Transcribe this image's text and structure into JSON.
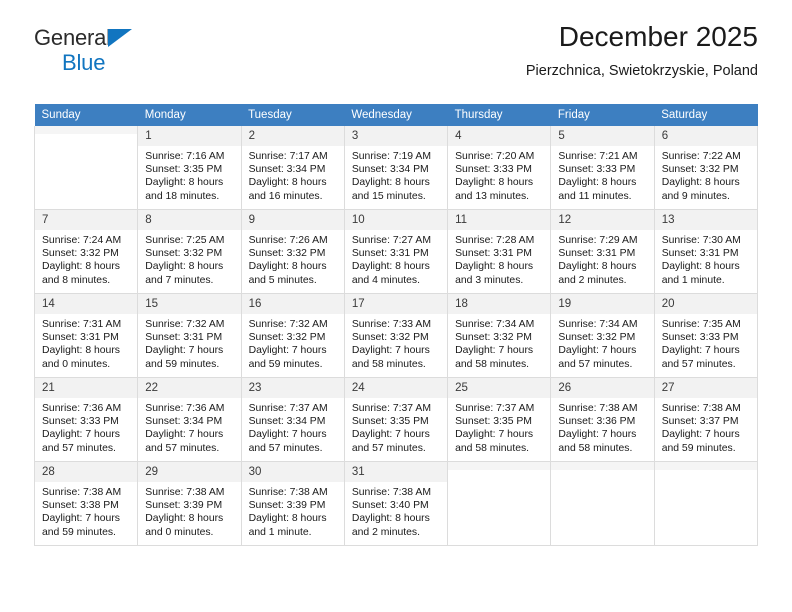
{
  "brand": {
    "line1": "General",
    "line2": "Blue",
    "triangle_icon": "triangle-logo-icon",
    "accent_color": "#1175c0"
  },
  "header": {
    "title": "December 2025",
    "subtitle": "Pierzchnica, Swietokrzyskie, Poland"
  },
  "calendar": {
    "header_bg": "#3d7fc1",
    "weekday_headers": [
      "Sunday",
      "Monday",
      "Tuesday",
      "Wednesday",
      "Thursday",
      "Friday",
      "Saturday"
    ],
    "weeks": [
      [
        {
          "day": "",
          "sunrise": "",
          "sunset": "",
          "daylight1": "",
          "daylight2": ""
        },
        {
          "day": "1",
          "sunrise": "Sunrise: 7:16 AM",
          "sunset": "Sunset: 3:35 PM",
          "daylight1": "Daylight: 8 hours",
          "daylight2": "and 18 minutes."
        },
        {
          "day": "2",
          "sunrise": "Sunrise: 7:17 AM",
          "sunset": "Sunset: 3:34 PM",
          "daylight1": "Daylight: 8 hours",
          "daylight2": "and 16 minutes."
        },
        {
          "day": "3",
          "sunrise": "Sunrise: 7:19 AM",
          "sunset": "Sunset: 3:34 PM",
          "daylight1": "Daylight: 8 hours",
          "daylight2": "and 15 minutes."
        },
        {
          "day": "4",
          "sunrise": "Sunrise: 7:20 AM",
          "sunset": "Sunset: 3:33 PM",
          "daylight1": "Daylight: 8 hours",
          "daylight2": "and 13 minutes."
        },
        {
          "day": "5",
          "sunrise": "Sunrise: 7:21 AM",
          "sunset": "Sunset: 3:33 PM",
          "daylight1": "Daylight: 8 hours",
          "daylight2": "and 11 minutes."
        },
        {
          "day": "6",
          "sunrise": "Sunrise: 7:22 AM",
          "sunset": "Sunset: 3:32 PM",
          "daylight1": "Daylight: 8 hours",
          "daylight2": "and 9 minutes."
        }
      ],
      [
        {
          "day": "7",
          "sunrise": "Sunrise: 7:24 AM",
          "sunset": "Sunset: 3:32 PM",
          "daylight1": "Daylight: 8 hours",
          "daylight2": "and 8 minutes."
        },
        {
          "day": "8",
          "sunrise": "Sunrise: 7:25 AM",
          "sunset": "Sunset: 3:32 PM",
          "daylight1": "Daylight: 8 hours",
          "daylight2": "and 7 minutes."
        },
        {
          "day": "9",
          "sunrise": "Sunrise: 7:26 AM",
          "sunset": "Sunset: 3:32 PM",
          "daylight1": "Daylight: 8 hours",
          "daylight2": "and 5 minutes."
        },
        {
          "day": "10",
          "sunrise": "Sunrise: 7:27 AM",
          "sunset": "Sunset: 3:31 PM",
          "daylight1": "Daylight: 8 hours",
          "daylight2": "and 4 minutes."
        },
        {
          "day": "11",
          "sunrise": "Sunrise: 7:28 AM",
          "sunset": "Sunset: 3:31 PM",
          "daylight1": "Daylight: 8 hours",
          "daylight2": "and 3 minutes."
        },
        {
          "day": "12",
          "sunrise": "Sunrise: 7:29 AM",
          "sunset": "Sunset: 3:31 PM",
          "daylight1": "Daylight: 8 hours",
          "daylight2": "and 2 minutes."
        },
        {
          "day": "13",
          "sunrise": "Sunrise: 7:30 AM",
          "sunset": "Sunset: 3:31 PM",
          "daylight1": "Daylight: 8 hours",
          "daylight2": "and 1 minute."
        }
      ],
      [
        {
          "day": "14",
          "sunrise": "Sunrise: 7:31 AM",
          "sunset": "Sunset: 3:31 PM",
          "daylight1": "Daylight: 8 hours",
          "daylight2": "and 0 minutes."
        },
        {
          "day": "15",
          "sunrise": "Sunrise: 7:32 AM",
          "sunset": "Sunset: 3:31 PM",
          "daylight1": "Daylight: 7 hours",
          "daylight2": "and 59 minutes."
        },
        {
          "day": "16",
          "sunrise": "Sunrise: 7:32 AM",
          "sunset": "Sunset: 3:32 PM",
          "daylight1": "Daylight: 7 hours",
          "daylight2": "and 59 minutes."
        },
        {
          "day": "17",
          "sunrise": "Sunrise: 7:33 AM",
          "sunset": "Sunset: 3:32 PM",
          "daylight1": "Daylight: 7 hours",
          "daylight2": "and 58 minutes."
        },
        {
          "day": "18",
          "sunrise": "Sunrise: 7:34 AM",
          "sunset": "Sunset: 3:32 PM",
          "daylight1": "Daylight: 7 hours",
          "daylight2": "and 58 minutes."
        },
        {
          "day": "19",
          "sunrise": "Sunrise: 7:34 AM",
          "sunset": "Sunset: 3:32 PM",
          "daylight1": "Daylight: 7 hours",
          "daylight2": "and 57 minutes."
        },
        {
          "day": "20",
          "sunrise": "Sunrise: 7:35 AM",
          "sunset": "Sunset: 3:33 PM",
          "daylight1": "Daylight: 7 hours",
          "daylight2": "and 57 minutes."
        }
      ],
      [
        {
          "day": "21",
          "sunrise": "Sunrise: 7:36 AM",
          "sunset": "Sunset: 3:33 PM",
          "daylight1": "Daylight: 7 hours",
          "daylight2": "and 57 minutes."
        },
        {
          "day": "22",
          "sunrise": "Sunrise: 7:36 AM",
          "sunset": "Sunset: 3:34 PM",
          "daylight1": "Daylight: 7 hours",
          "daylight2": "and 57 minutes."
        },
        {
          "day": "23",
          "sunrise": "Sunrise: 7:37 AM",
          "sunset": "Sunset: 3:34 PM",
          "daylight1": "Daylight: 7 hours",
          "daylight2": "and 57 minutes."
        },
        {
          "day": "24",
          "sunrise": "Sunrise: 7:37 AM",
          "sunset": "Sunset: 3:35 PM",
          "daylight1": "Daylight: 7 hours",
          "daylight2": "and 57 minutes."
        },
        {
          "day": "25",
          "sunrise": "Sunrise: 7:37 AM",
          "sunset": "Sunset: 3:35 PM",
          "daylight1": "Daylight: 7 hours",
          "daylight2": "and 58 minutes."
        },
        {
          "day": "26",
          "sunrise": "Sunrise: 7:38 AM",
          "sunset": "Sunset: 3:36 PM",
          "daylight1": "Daylight: 7 hours",
          "daylight2": "and 58 minutes."
        },
        {
          "day": "27",
          "sunrise": "Sunrise: 7:38 AM",
          "sunset": "Sunset: 3:37 PM",
          "daylight1": "Daylight: 7 hours",
          "daylight2": "and 59 minutes."
        }
      ],
      [
        {
          "day": "28",
          "sunrise": "Sunrise: 7:38 AM",
          "sunset": "Sunset: 3:38 PM",
          "daylight1": "Daylight: 7 hours",
          "daylight2": "and 59 minutes."
        },
        {
          "day": "29",
          "sunrise": "Sunrise: 7:38 AM",
          "sunset": "Sunset: 3:39 PM",
          "daylight1": "Daylight: 8 hours",
          "daylight2": "and 0 minutes."
        },
        {
          "day": "30",
          "sunrise": "Sunrise: 7:38 AM",
          "sunset": "Sunset: 3:39 PM",
          "daylight1": "Daylight: 8 hours",
          "daylight2": "and 1 minute."
        },
        {
          "day": "31",
          "sunrise": "Sunrise: 7:38 AM",
          "sunset": "Sunset: 3:40 PM",
          "daylight1": "Daylight: 8 hours",
          "daylight2": "and 2 minutes."
        },
        {
          "day": "",
          "sunrise": "",
          "sunset": "",
          "daylight1": "",
          "daylight2": ""
        },
        {
          "day": "",
          "sunrise": "",
          "sunset": "",
          "daylight1": "",
          "daylight2": ""
        },
        {
          "day": "",
          "sunrise": "",
          "sunset": "",
          "daylight1": "",
          "daylight2": ""
        }
      ]
    ]
  }
}
